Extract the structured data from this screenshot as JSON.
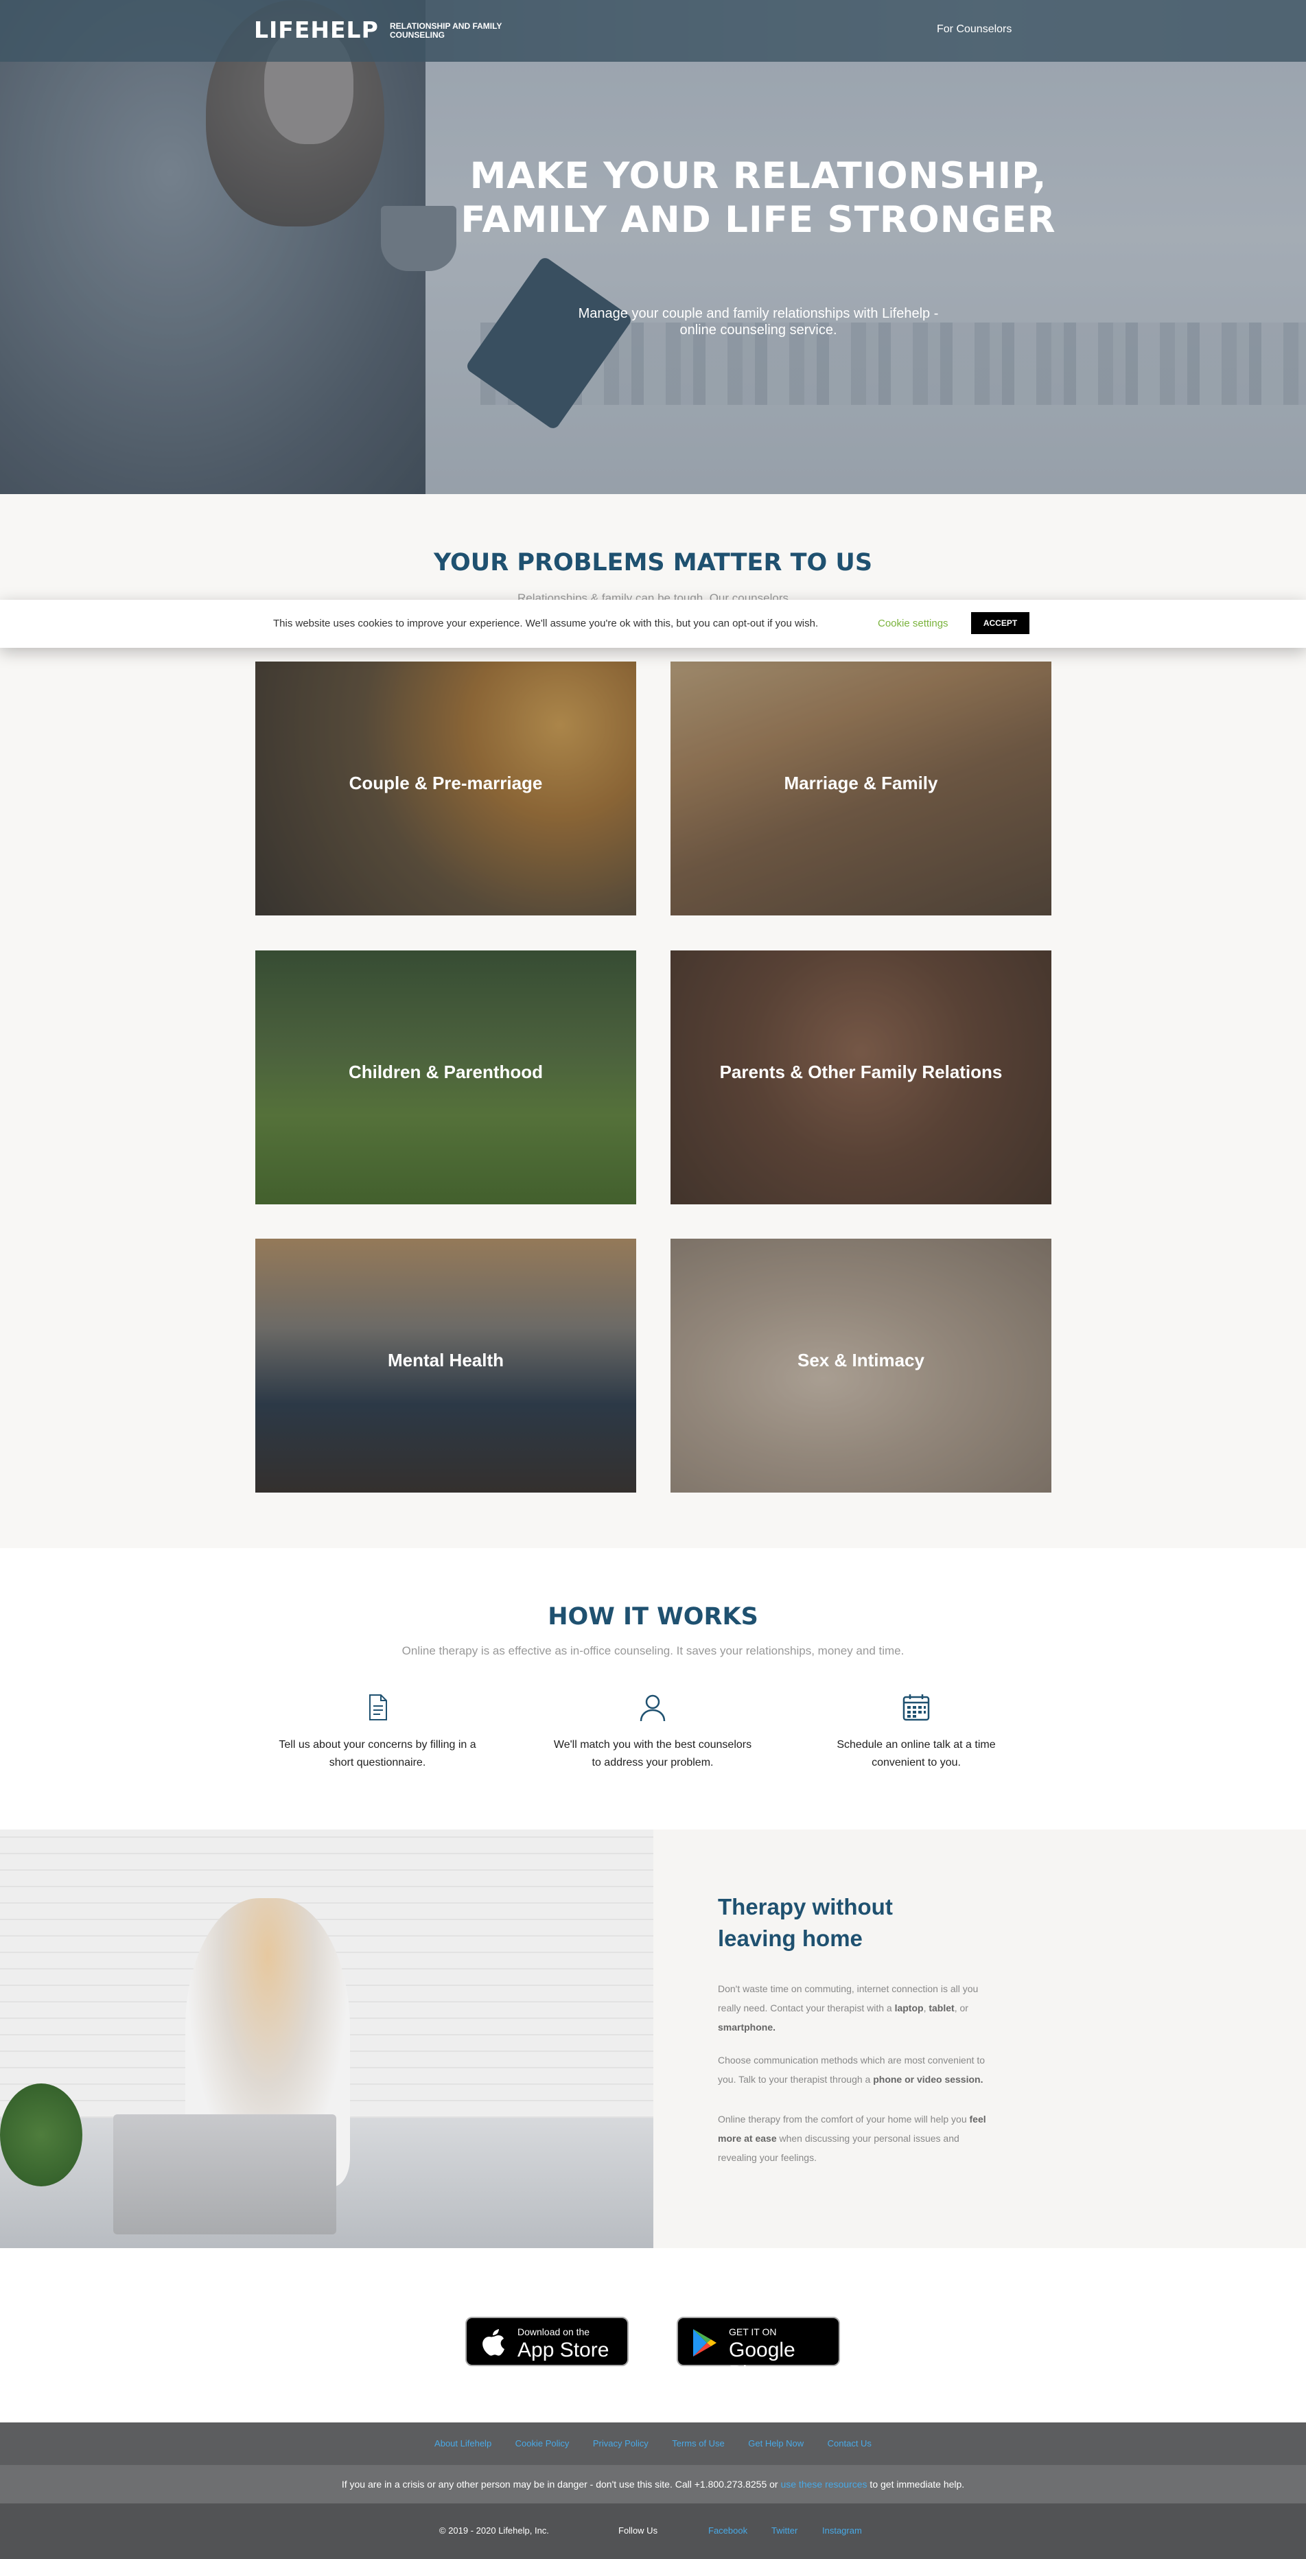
{
  "header": {
    "logo": "LIFEHELP",
    "tagline": "RELATIONSHIP AND FAMILY COUNSELING",
    "nav_counselors": "For Counselors"
  },
  "hero": {
    "title": "MAKE YOUR RELATIONSHIP, FAMILY AND LIFE STRONGER",
    "subtitle": "Manage your couple and family relationships with Lifehelp - online counseling service."
  },
  "problems": {
    "title": "YOUR PROBLEMS MATTER TO US",
    "subtitle": "Relationships & family can be tough. Our counselors",
    "cards": [
      {
        "label": "Couple & Pre-marriage"
      },
      {
        "label": "Marriage & Family"
      },
      {
        "label": "Children & Parenthood"
      },
      {
        "label": "Parents & Other Family Relations"
      },
      {
        "label": "Mental Health"
      },
      {
        "label": "Sex & Intimacy"
      }
    ]
  },
  "cookie": {
    "text": "This website uses cookies to improve your experience. We'll assume you're ok with this, but you can opt-out if you wish.",
    "settings_label": "Cookie settings",
    "accept_label": "ACCEPT"
  },
  "how": {
    "title": "HOW IT WORKS",
    "subtitle": "Online therapy is as effective as in-office counseling. It saves your relationships, money and time.",
    "steps": [
      {
        "text": "Tell us about your concerns by filling in a short questionnaire.",
        "icon": "document-icon"
      },
      {
        "text": "We'll match you with the best counselors to address your problem.",
        "icon": "user-icon"
      },
      {
        "text": "Schedule an online talk at a time convenient to you.",
        "icon": "calendar-icon"
      }
    ]
  },
  "therapy": {
    "title": "Therapy without leaving home",
    "p1_a": "Don't waste time on commuting, internet connection is all you really need. Contact your therapist with a ",
    "p1_b1": "laptop",
    "p1_c": ", ",
    "p1_b2": "tablet",
    "p1_d": ", or ",
    "p1_b3": "smartphone.",
    "p2_a": "Choose communication methods which are most convenient to you. Talk to your therapist through a ",
    "p2_b": "phone or video session.",
    "p3_a": "Online therapy from the comfort of your home will help you ",
    "p3_b": "feel more at ease",
    "p3_c": " when discussing your personal issues and revealing your feelings."
  },
  "apps": {
    "appstore_small": "Download on the",
    "appstore_big": "App Store",
    "gplay_small": "GET IT ON",
    "gplay_big": "Google Play"
  },
  "footer": {
    "links": [
      "About Lifehelp",
      "Cookie Policy",
      "Privacy Policy",
      "Terms of Use",
      "Get Help Now",
      "Contact Us"
    ],
    "crisis_a": "If you are in a crisis or any other person may be in danger - don't use this site. Call +1.800.273.8255 or ",
    "crisis_link": "use these resources",
    "crisis_b": " to get immediate help.",
    "copyright": "© 2019 - 2020 Lifehelp, Inc.",
    "follow_us": "Follow Us",
    "facebook": "Facebook",
    "twitter": "Twitter",
    "instagram": "Instagram"
  },
  "colors": {
    "accent": "#1f5170",
    "link": "#48a9e6",
    "cookie_settings": "#7ab33c"
  }
}
